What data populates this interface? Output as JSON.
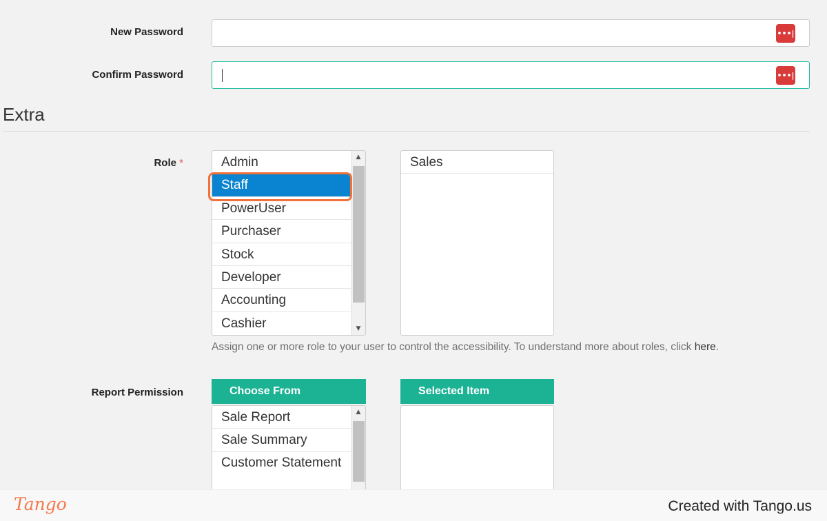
{
  "form": {
    "new_password_label": "New Password",
    "confirm_password_label": "Confirm Password",
    "password_badge": "•••|",
    "section_title": "Extra",
    "role_label": "Role",
    "required_mark": "*",
    "role_options": [
      "Admin",
      "Staff",
      "PowerUser",
      "Purchaser",
      "Stock",
      "Developer",
      "Accounting",
      "Cashier"
    ],
    "selected_role_index": 1,
    "assigned_roles": [
      "Sales"
    ],
    "role_help": "Assign one or more role to your user to control the accessibility. To understand more about roles, click ",
    "role_help_link": "here",
    "role_help_end": ".",
    "report_permission_label": "Report Permission",
    "choose_from_header": "Choose From",
    "selected_item_header": "Selected Item",
    "report_options": [
      "Sale Report",
      "Sale Summary",
      "Customer Statement"
    ]
  },
  "footer": {
    "logo": "Tango",
    "created_with": "Created with Tango.us"
  },
  "colors": {
    "accent": "#1cb394",
    "selection": "#0a84d0",
    "highlight": "#f0723a",
    "badge": "#d93a3a"
  },
  "icons": {
    "password_manager": "password-dots-icon",
    "scroll_up": "chevron-up-icon",
    "scroll_down": "chevron-down-icon"
  }
}
